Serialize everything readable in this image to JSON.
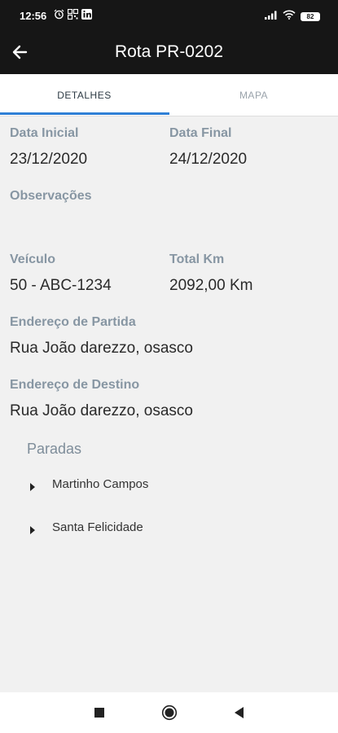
{
  "status_bar": {
    "time": "12:56",
    "battery": "82"
  },
  "app_bar": {
    "title": "Rota PR-0202"
  },
  "tabs": [
    {
      "label": "DETALHES"
    },
    {
      "label": "MAPA"
    }
  ],
  "details": {
    "data_inicial": {
      "label": "Data Inicial",
      "value": "23/12/2020"
    },
    "data_final": {
      "label": "Data Final",
      "value": "24/12/2020"
    },
    "observacoes": {
      "label": "Observações",
      "value": ""
    },
    "veiculo": {
      "label": "Veículo",
      "value": "50 - ABC-1234"
    },
    "total_km": {
      "label": "Total Km",
      "value": "2092,00 Km"
    },
    "endereco_partida": {
      "label": "Endereço de Partida",
      "value": "Rua João darezzo, osasco"
    },
    "endereco_destino": {
      "label": "Endereço de Destino",
      "value": "Rua João darezzo, osasco"
    }
  },
  "paradas": {
    "title": "Paradas",
    "items": [
      {
        "label": "Martinho Campos"
      },
      {
        "label": "Santa Felicidade"
      }
    ]
  },
  "colors": {
    "accent": "#2e7fd6",
    "app_bar": "#161616",
    "label": "#8796a3"
  }
}
